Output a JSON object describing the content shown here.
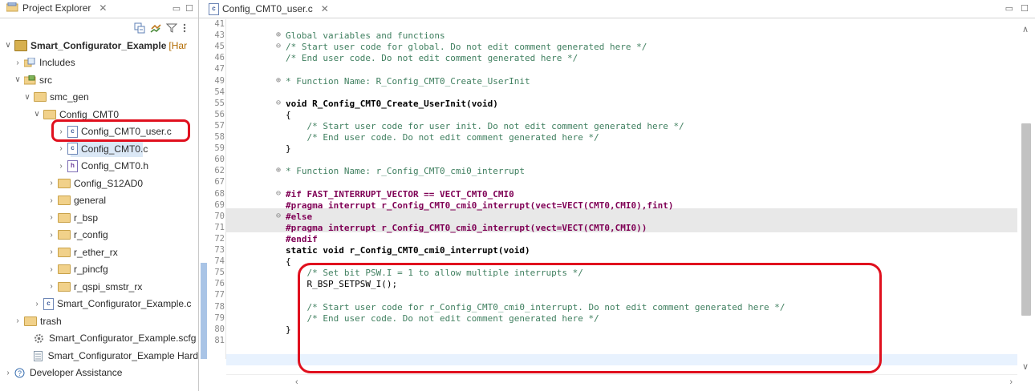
{
  "left_panel": {
    "tab_label": "Project Explorer",
    "tree": [
      {
        "label": "Smart_Configurator_Example",
        "suffix": "[Har",
        "depth": 0,
        "arrow": "v",
        "icon": "project"
      },
      {
        "label": "Includes",
        "depth": 1,
        "arrow": ">",
        "icon": "includes"
      },
      {
        "label": "src",
        "depth": 1,
        "arrow": "v",
        "icon": "folder"
      },
      {
        "label": "smc_gen",
        "depth": 2,
        "arrow": "v",
        "icon": "folder"
      },
      {
        "label": "Config_CMT0",
        "depth": 3,
        "arrow": "v",
        "icon": "folder"
      },
      {
        "label": "Config_CMT0_user.c",
        "depth": 4,
        "arrow": ">",
        "icon": "c-file"
      },
      {
        "label": "Config_CMT0.c",
        "depth": 4,
        "arrow": ">",
        "icon": "c-file"
      },
      {
        "label": "Config_CMT0.h",
        "depth": 4,
        "arrow": ">",
        "icon": "h-file"
      },
      {
        "label": "Config_S12AD0",
        "depth": 3,
        "arrow": ">",
        "icon": "folder"
      },
      {
        "label": "general",
        "depth": 3,
        "arrow": ">",
        "icon": "folder"
      },
      {
        "label": "r_bsp",
        "depth": 3,
        "arrow": ">",
        "icon": "folder"
      },
      {
        "label": "r_config",
        "depth": 3,
        "arrow": ">",
        "icon": "folder"
      },
      {
        "label": "r_ether_rx",
        "depth": 3,
        "arrow": ">",
        "icon": "folder"
      },
      {
        "label": "r_pincfg",
        "depth": 3,
        "arrow": ">",
        "icon": "folder"
      },
      {
        "label": "r_qspi_smstr_rx",
        "depth": 3,
        "arrow": ">",
        "icon": "folder"
      },
      {
        "label": "Smart_Configurator_Example.c",
        "depth": 2,
        "arrow": ">",
        "icon": "c-file"
      },
      {
        "label": "trash",
        "depth": 0,
        "arrow": ">",
        "icon": "folder"
      },
      {
        "label": "Smart_Configurator_Example.scfg",
        "depth": 1,
        "arrow": "",
        "icon": "gear-file"
      },
      {
        "label": "Smart_Configurator_Example Hard",
        "depth": 1,
        "arrow": "",
        "icon": "doc-file"
      },
      {
        "label": "Developer Assistance",
        "depth": 0,
        "arrow": ">",
        "icon": "help"
      }
    ]
  },
  "editor": {
    "tab_label": "Config_CMT0_user.c",
    "lines": [
      {
        "n": "41",
        "text": ""
      },
      {
        "n": "43",
        "text": "Global variables and functions"
      },
      {
        "n": "45",
        "text": "/* Start user code for global. Do not edit comment generated here */"
      },
      {
        "n": "46",
        "text": "/* End user code. Do not edit comment generated here */"
      },
      {
        "n": "47",
        "text": ""
      },
      {
        "n": "49",
        "text": "* Function Name: R_Config_CMT0_Create_UserInit"
      },
      {
        "n": "54",
        "text": ""
      },
      {
        "n": "55",
        "text": "void R_Config_CMT0_Create_UserInit(void)"
      },
      {
        "n": "56",
        "text": "{"
      },
      {
        "n": "57",
        "text": "    /* Start user code for user init. Do not edit comment generated here */"
      },
      {
        "n": "58",
        "text": "    /* End user code. Do not edit comment generated here */"
      },
      {
        "n": "59",
        "text": "}"
      },
      {
        "n": "60",
        "text": ""
      },
      {
        "n": "62",
        "text": "* Function Name: r_Config_CMT0_cmi0_interrupt"
      },
      {
        "n": "67",
        "text": ""
      },
      {
        "n": "68",
        "text": "#if FAST_INTERRUPT_VECTOR == VECT_CMT0_CMI0"
      },
      {
        "n": "69",
        "text": "#pragma interrupt r_Config_CMT0_cmi0_interrupt(vect=VECT(CMT0,CMI0),fint)"
      },
      {
        "n": "70",
        "text": "#else"
      },
      {
        "n": "71",
        "text": "#pragma interrupt r_Config_CMT0_cmi0_interrupt(vect=VECT(CMT0,CMI0))"
      },
      {
        "n": "72",
        "text": "#endif"
      },
      {
        "n": "73",
        "text": "static void r_Config_CMT0_cmi0_interrupt(void)"
      },
      {
        "n": "74",
        "text": "{"
      },
      {
        "n": "75",
        "text": "    /* Set bit PSW.I = 1 to allow multiple interrupts */"
      },
      {
        "n": "76",
        "text": "    R_BSP_SETPSW_I();"
      },
      {
        "n": "77",
        "text": ""
      },
      {
        "n": "78",
        "text": "    /* Start user code for r_Config_CMT0_cmi0_interrupt. Do not edit comment generated here */"
      },
      {
        "n": "79",
        "text": "    /* End user code. Do not edit comment generated here */"
      },
      {
        "n": "80",
        "text": "}"
      },
      {
        "n": "81",
        "text": ""
      }
    ]
  }
}
